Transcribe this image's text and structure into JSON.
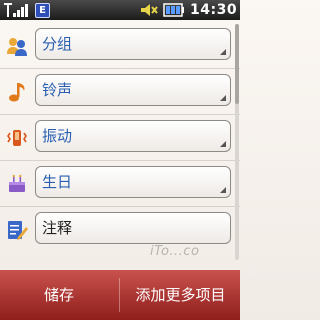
{
  "status_bar": {
    "network_badge": "E",
    "time": "14:30",
    "icons": [
      "signal-icon",
      "network-e-icon",
      "mute-icon",
      "battery-icon"
    ]
  },
  "form": {
    "fields": [
      {
        "label": "分组",
        "icon": "group-icon",
        "has_dropdown": true
      },
      {
        "label": "铃声",
        "icon": "ringtone-icon",
        "has_dropdown": true
      },
      {
        "label": "振动",
        "icon": "vibration-icon",
        "has_dropdown": true
      },
      {
        "label": "生日",
        "icon": "birthday-icon",
        "has_dropdown": true
      },
      {
        "label": "注释",
        "icon": "note-icon",
        "has_dropdown": false
      }
    ]
  },
  "softkeys": {
    "left": "储存",
    "right": "添加更多项目"
  },
  "watermark": "iTo...co",
  "colors": {
    "field_label": "#2a5fb0",
    "softbar_top": "#c9524e",
    "softbar_bottom": "#8f1e1c"
  }
}
